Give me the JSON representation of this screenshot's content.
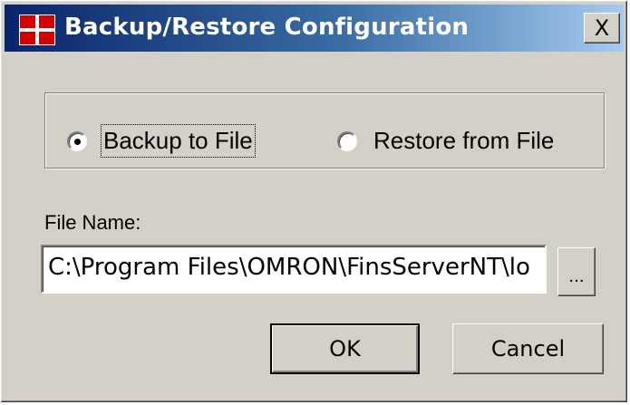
{
  "window": {
    "title": "Backup/Restore Configuration",
    "close_label": "X"
  },
  "mode": {
    "options": [
      {
        "label": "Backup to File",
        "selected": true
      },
      {
        "label": "Restore from File",
        "selected": false
      }
    ]
  },
  "file": {
    "label": "File Name:",
    "value": "C:\\Program Files\\OMRON\\FinsServerNT\\lo",
    "browse_label": "..."
  },
  "buttons": {
    "ok": "OK",
    "cancel": "Cancel"
  },
  "colors": {
    "title_bar_start": "#0a246a",
    "title_bar_end": "#a6caf0",
    "face": "#d4d0c8"
  },
  "icons": {
    "app": "red-plus-cross-icon",
    "close": "close-icon"
  }
}
